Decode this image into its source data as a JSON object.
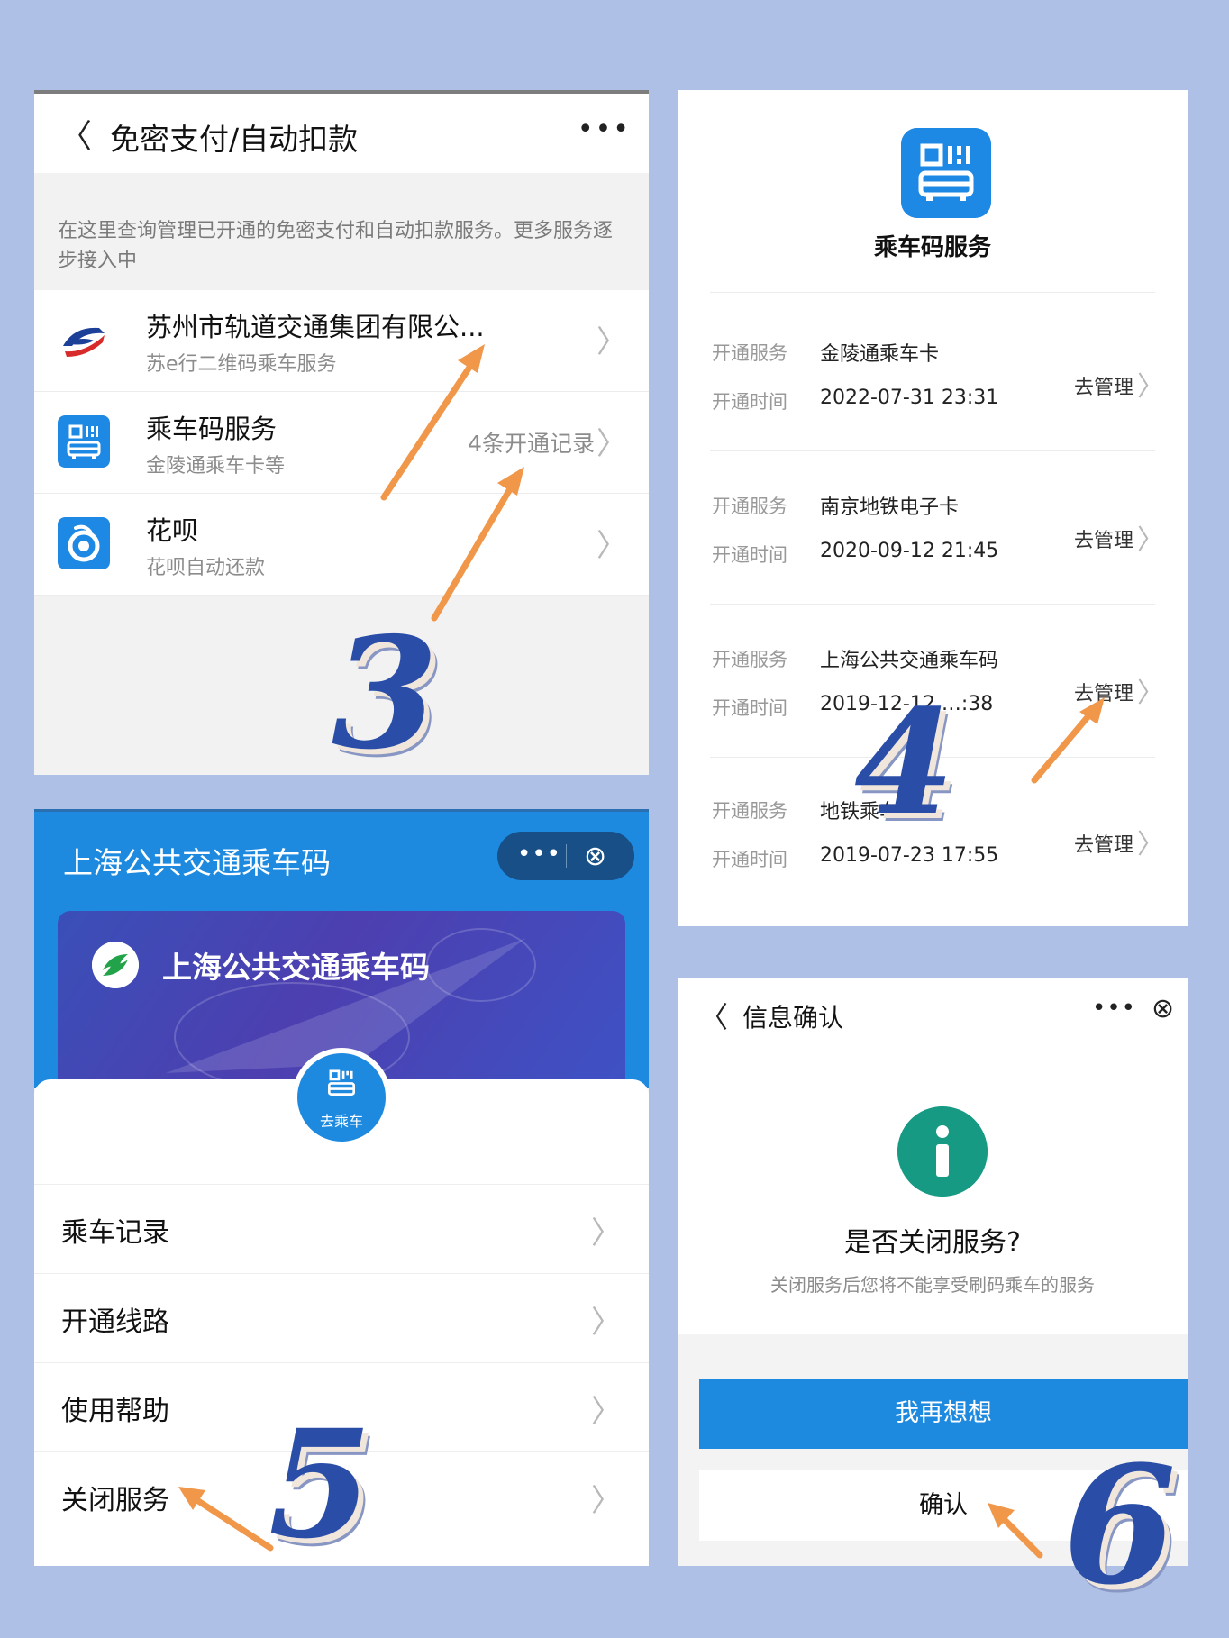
{
  "panel1": {
    "back_icon": "chevron-left-icon",
    "title": "免密支付/自动扣款",
    "more_icon": "more-dots-icon",
    "description": "在这里查询管理已开通的免密支付和自动扣款服务。更多服务逐步接入中",
    "items": [
      {
        "icon": "suzhou-metro-logo-icon",
        "name": "苏州市轨道交通集团有限公...",
        "sub": "苏e行二维码乘车服务",
        "extra": ""
      },
      {
        "icon": "qr-transit-icon",
        "name": "乘车码服务",
        "sub": "金陵通乘车卡等",
        "extra": "4条开通记录"
      },
      {
        "icon": "huabei-icon",
        "name": "花呗",
        "sub": "花呗自动还款",
        "extra": ""
      }
    ]
  },
  "panel2": {
    "app_icon": "qr-transit-icon",
    "app_title": "乘车码服务",
    "service_label": "开通服务",
    "time_label": "开通时间",
    "manage_label": "去管理",
    "records": [
      {
        "service": "金陵通乘车卡",
        "time": "2022-07-31 23:31"
      },
      {
        "service": "南京地铁电子卡",
        "time": "2020-09-12 21:45"
      },
      {
        "service": "上海公共交通乘车码",
        "time": "2019-12-12 …:38"
      },
      {
        "service": "地铁乘车…",
        "time": "2019-07-23 17:55"
      }
    ]
  },
  "panel3": {
    "header_title": "上海公共交通乘车码",
    "more_icon": "more-dots-icon",
    "close_icon": "close-circle-icon",
    "card_logo": "shanghai-transit-logo-icon",
    "card_title": "上海公共交通乘车码",
    "ride_button_icon": "qr-transit-icon",
    "ride_button_label": "去乘车",
    "menu": [
      "乘车记录",
      "开通线路",
      "使用帮助",
      "关闭服务"
    ]
  },
  "panel4": {
    "back_icon": "chevron-left-icon",
    "title": "信息确认",
    "more_icon": "more-dots-icon",
    "close_icon": "close-circle-icon",
    "info_icon": "info-icon",
    "question": "是否关闭服务?",
    "subtext": "关闭服务后您将不能享受刷码乘车的服务",
    "primary_button": "我再想想",
    "confirm_button": "确认"
  },
  "steps": {
    "s3": "3",
    "s4": "4",
    "s5": "5",
    "s6": "6"
  },
  "colors": {
    "background": "#aec0e6",
    "accent_blue": "#1d8ae0",
    "info_green": "#169a84",
    "arrow_orange": "#f0974a",
    "numeral_blue": "#2a4ea8"
  }
}
